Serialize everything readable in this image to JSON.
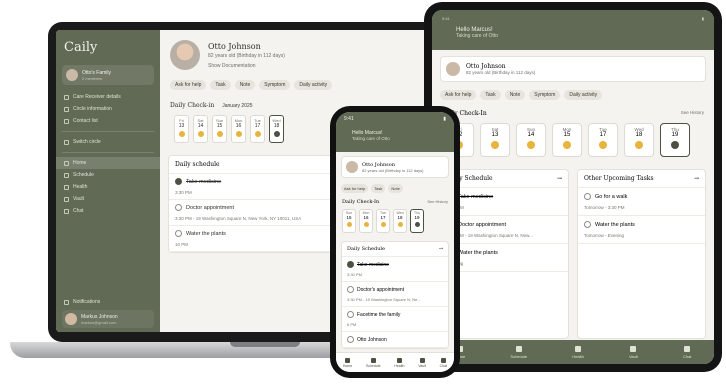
{
  "brand": "Caily",
  "family": {
    "name": "Otto's Family",
    "members": "2 members"
  },
  "sidebar": {
    "items": [
      {
        "label": "Care Receiver details"
      },
      {
        "label": "Circle information"
      },
      {
        "label": "Contact list"
      },
      {
        "label": "Switch circle"
      },
      {
        "label": "Home"
      },
      {
        "label": "Schedule"
      },
      {
        "label": "Health"
      },
      {
        "label": "Vault"
      },
      {
        "label": "Chat"
      }
    ],
    "notifications": "Notifications",
    "user": {
      "name": "Markus Johnson",
      "email": "markus@gmail.com"
    }
  },
  "profile": {
    "name": "Otto Johnson",
    "age": "82 years old (Birthday in 112 days)",
    "docs": "Show Documentation"
  },
  "actions": [
    "Ask for help",
    "Task",
    "Note",
    "Symptom",
    "Daily activity"
  ],
  "checkin": {
    "title": "Daily Check-in",
    "month": "January 2025",
    "see_history": "See History",
    "days": [
      {
        "dn": "Fri",
        "dd": "13"
      },
      {
        "dn": "Sat",
        "dd": "14"
      },
      {
        "dn": "Sun",
        "dd": "15"
      },
      {
        "dn": "Mon",
        "dd": "16"
      },
      {
        "dn": "Tue",
        "dd": "17"
      },
      {
        "dn": "Wed",
        "dd": "18"
      }
    ]
  },
  "schedule": {
    "title": "Daily schedule",
    "items": [
      {
        "title": "Take medicine",
        "time": "3:30 PM",
        "done": true
      },
      {
        "title": "Doctor appointment",
        "time": "3:30 PM - 19 Washington Square N, New York, NY 10011, USA",
        "done": false
      },
      {
        "title": "Water the plants",
        "time": "10 PM",
        "done": false
      }
    ]
  },
  "tablet": {
    "status_time": "9:41",
    "hello": "Hello Marcus!",
    "taking_care": "Taking care of Otto",
    "profile_name": "Otto Johnson",
    "profile_sub": "82 years old (Birthday in 112 days)",
    "checkin_title": "Daily Check-In",
    "see_history": "See History",
    "days": [
      {
        "dn": "Fri",
        "dd": "12"
      },
      {
        "dn": "Sat",
        "dd": "13"
      },
      {
        "dn": "Sun",
        "dd": "14"
      },
      {
        "dn": "Mon",
        "dd": "15"
      },
      {
        "dn": "Tue",
        "dd": "17"
      },
      {
        "dn": "Wed",
        "dd": "18"
      },
      {
        "dn": "Thu",
        "dd": "19"
      }
    ],
    "schedule_title": "Daily Schedule",
    "schedule": [
      {
        "title": "Take medicine",
        "time": "3:30 PM"
      },
      {
        "title": "Doctor appointment",
        "time": "3:30 PM - 19 Washington Square N, New..."
      },
      {
        "title": "Water the plants",
        "time": "Evening"
      }
    ],
    "other_title": "Other Upcoming Tasks",
    "other": [
      {
        "title": "Go for a walk",
        "time": "Tomorrow - 3:30 PM"
      },
      {
        "title": "Water the plants",
        "time": "Tomorrow - Evening"
      }
    ],
    "nav": [
      "Home",
      "Schedule",
      "Health",
      "Vault",
      "Chat"
    ]
  },
  "phone": {
    "status_time": "9:41",
    "hello": "Hello Marcus!",
    "taking_care": "Taking care of Otto",
    "profile_name": "Otto Johnson",
    "profile_sub": "82 years old (Birthday in 112 days)",
    "chips": [
      "Ask for help",
      "Task",
      "Note"
    ],
    "checkin_title": "Daily Check-In",
    "see_history": "See History",
    "days": [
      {
        "dn": "Sun",
        "dd": "15"
      },
      {
        "dn": "Mon",
        "dd": "16"
      },
      {
        "dn": "Tue",
        "dd": "17"
      },
      {
        "dn": "Wed",
        "dd": "18"
      },
      {
        "dn": "Thu",
        "dd": "19"
      }
    ],
    "schedule_title": "Daily Schedule",
    "schedule": [
      {
        "title": "Take medicine",
        "time": "3:30 PM",
        "done": true
      },
      {
        "title": "Doctor's appointment",
        "time": "3:30 PM - 19 Washington Square N, Ne...",
        "done": false
      },
      {
        "title": "Facetime the family",
        "time": "6 PM",
        "done": false
      },
      {
        "title": "Otto Johnson",
        "time": "",
        "done": false
      }
    ],
    "nav": [
      "Home",
      "Schedule",
      "Health",
      "Vault",
      "Chat"
    ]
  }
}
